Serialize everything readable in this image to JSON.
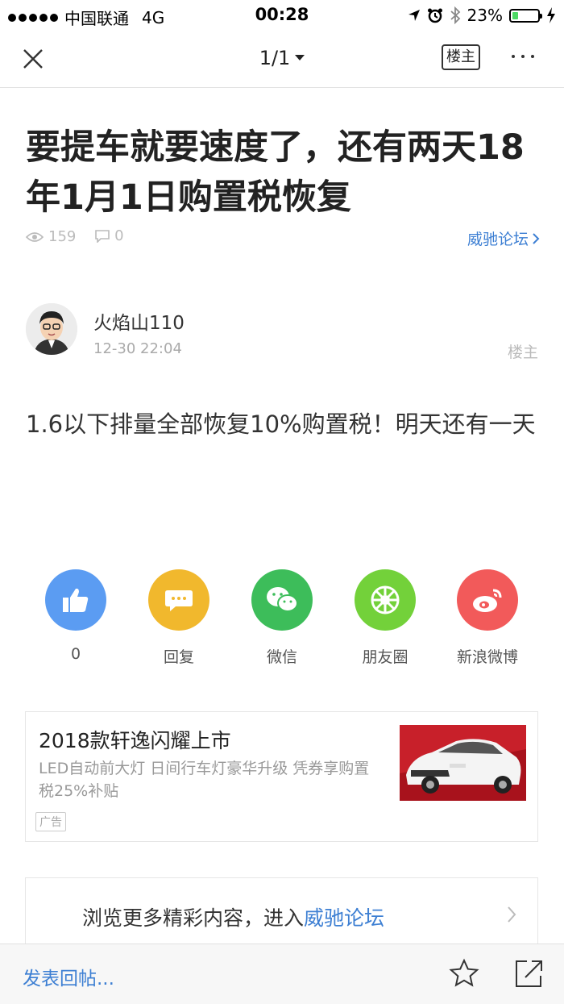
{
  "status_bar": {
    "carrier": "中国联通",
    "network": "4G",
    "time": "00:28",
    "battery_percent": "23%",
    "battery_level": 0.23
  },
  "nav": {
    "pager": "1/1",
    "owner_button": "楼主"
  },
  "post": {
    "title": "要提车就要速度了，还有两天18年1月1日购置税恢复",
    "views": "159",
    "comments": "0",
    "forum": "威驰论坛",
    "author_name": "火焰山110",
    "author_time": "12-30 22:04",
    "owner_tag": "楼主",
    "content": "1.6以下排量全部恢复10%购置税！明天还有一天"
  },
  "share": {
    "items": [
      {
        "label": "0",
        "icon": "thumbs-up-icon",
        "color": "#5b9cf2"
      },
      {
        "label": "回复",
        "icon": "chat-bubble-icon",
        "color": "#f1b82d"
      },
      {
        "label": "微信",
        "icon": "wechat-icon",
        "color": "#3dbd5a"
      },
      {
        "label": "朋友圈",
        "icon": "moments-icon",
        "color": "#73d13a"
      },
      {
        "label": "新浪微博",
        "icon": "weibo-icon",
        "color": "#f25a5a"
      }
    ]
  },
  "ad": {
    "title": "2018款轩逸闪耀上市",
    "description": "LED自动前大灯 日间行车灯豪华升级 凭券享购置税25%补贴",
    "tag": "广告"
  },
  "more": {
    "prefix": "浏览更多精彩内容，进入",
    "link": "威驰论坛"
  },
  "toolbar": {
    "reply_placeholder": "发表回帖..."
  },
  "colors": {
    "accent": "#3d7fd3",
    "text": "#222222",
    "muted": "#aaaaaa"
  }
}
